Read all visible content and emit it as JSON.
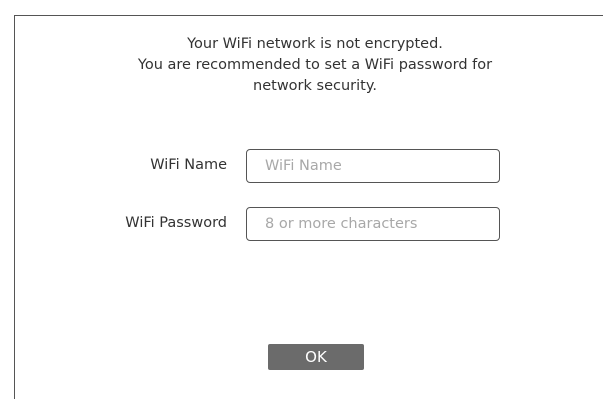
{
  "notice": {
    "line1": "Your WiFi network is not encrypted.",
    "line2": "You are recommended to set a WiFi password for",
    "line3": "network security."
  },
  "form": {
    "wifi_name_label": "WiFi Name",
    "wifi_name_value": "",
    "wifi_name_placeholder": "WiFi Name",
    "wifi_password_label": "WiFi Password",
    "wifi_password_value": "",
    "wifi_password_placeholder": "8 or more characters"
  },
  "actions": {
    "ok_label": "OK"
  },
  "colors": {
    "button_background": "#6b6b6b",
    "text": "#333333",
    "placeholder": "#a8a8a8",
    "border": "#555555"
  }
}
